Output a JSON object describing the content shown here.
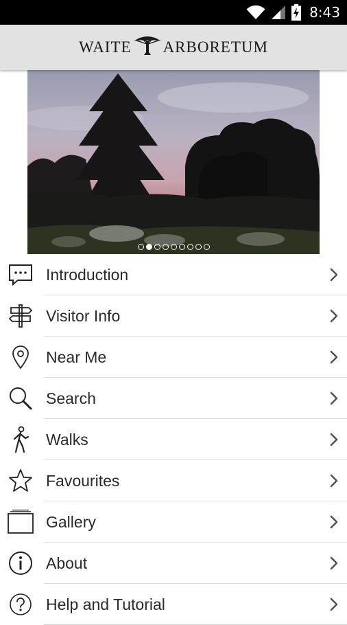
{
  "status_bar": {
    "time": "8:43"
  },
  "header": {
    "logo_left": "WAITE",
    "logo_right": "ARBORETUM"
  },
  "carousel": {
    "page_count": 9,
    "active_index": 1
  },
  "menu": [
    {
      "label": "Introduction",
      "icon": "speech-bubble-icon"
    },
    {
      "label": "Visitor Info",
      "icon": "signpost-icon"
    },
    {
      "label": "Near Me",
      "icon": "location-pin-icon"
    },
    {
      "label": "Search",
      "icon": "magnifier-icon"
    },
    {
      "label": "Walks",
      "icon": "walking-person-icon"
    },
    {
      "label": "Favourites",
      "icon": "star-icon"
    },
    {
      "label": "Gallery",
      "icon": "gallery-icon"
    },
    {
      "label": "About",
      "icon": "info-icon"
    },
    {
      "label": "Help and Tutorial",
      "icon": "help-icon"
    }
  ]
}
